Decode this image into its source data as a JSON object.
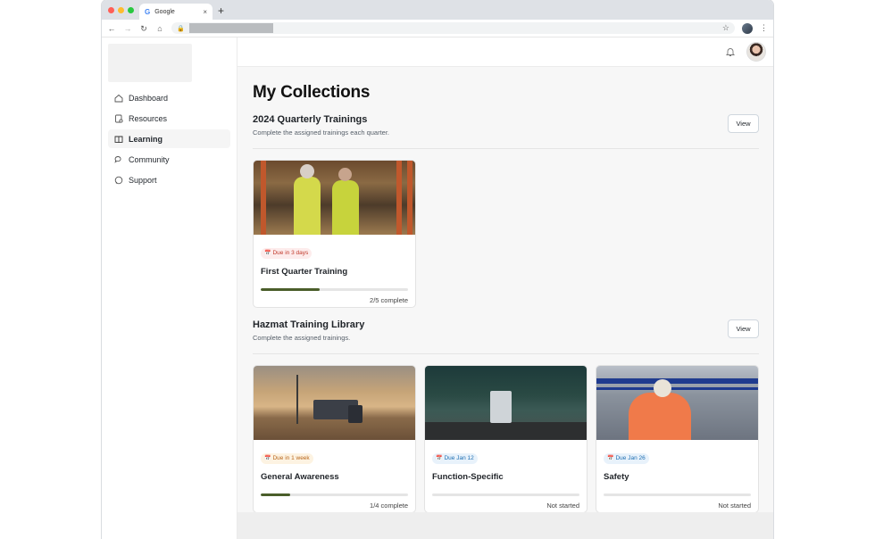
{
  "browser": {
    "tab_title": "Google",
    "tab_favicon": "G",
    "tab_close": "×",
    "new_tab": "+",
    "icons": [
      "back-icon",
      "forward-icon",
      "reload-icon",
      "home-icon",
      "lock-icon",
      "star-icon",
      "profile-icon",
      "menu-icon"
    ]
  },
  "sidebar": {
    "items": [
      {
        "label": "Dashboard",
        "icon": "home-icon",
        "active": false
      },
      {
        "label": "Resources",
        "icon": "resources-icon",
        "active": false
      },
      {
        "label": "Learning",
        "icon": "book-icon",
        "active": true
      },
      {
        "label": "Community",
        "icon": "chat-bubbles-icon",
        "active": false
      },
      {
        "label": "Support",
        "icon": "support-bubble-icon",
        "active": false
      }
    ]
  },
  "header": {
    "icons": [
      "bell-icon",
      "avatar"
    ]
  },
  "main": {
    "page_title": "My Collections",
    "sections": [
      {
        "title": "2024 Quarterly Trainings",
        "subtitle": "Complete the assigned trainings each quarter.",
        "view_label": "View",
        "cards": [
          {
            "badge": "Due in 3 days",
            "badge_color": "#c0392b",
            "title": "First Quarter Training",
            "progress": 0.4,
            "progress_text": "2/5 complete",
            "image": "warehouse"
          }
        ]
      },
      {
        "title": "Hazmat Training Library",
        "subtitle": "Complete the assigned trainings.",
        "view_label": "View",
        "cards": [
          {
            "badge": "Due in 1 week",
            "badge_color": "#b8661b",
            "title": "General Awareness",
            "progress": 0.2,
            "progress_text": "1/4 complete",
            "image": "desert"
          },
          {
            "badge": "Due Jan 12",
            "badge_color": "#1f6fb2",
            "title": "Function-Specific",
            "progress": 0,
            "progress_text": "Not started",
            "image": "night"
          },
          {
            "badge": "Due Jan 26",
            "badge_color": "#1f6fb2",
            "title": "Safety",
            "progress": 0,
            "progress_text": "Not started",
            "image": "safety"
          }
        ]
      }
    ]
  },
  "colors": {
    "progress_fill": "#4a5e2a",
    "active_nav_bg": "#f5f5f5",
    "main_bg": "#f7f7f7"
  }
}
